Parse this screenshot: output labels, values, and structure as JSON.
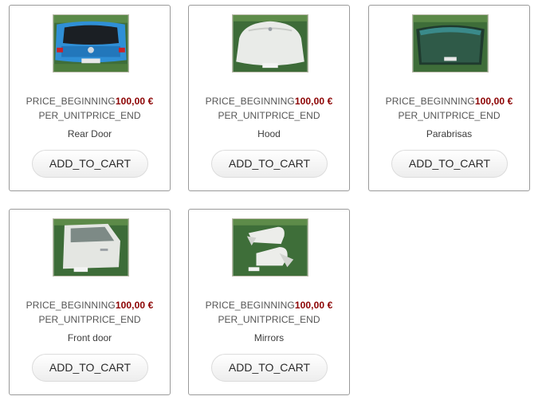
{
  "price_label": "PRICE_BEGINNING",
  "unit_label": "PER_UNITPRICE_END",
  "button_label": "ADD_TO_CART",
  "products": [
    {
      "name": "Rear Door",
      "price": "100,00 €",
      "image_icon": "rear-door-image"
    },
    {
      "name": "Hood",
      "price": "100,00 €",
      "image_icon": "hood-image"
    },
    {
      "name": "Parabrisas",
      "price": "100,00 €",
      "image_icon": "windshield-image"
    },
    {
      "name": "Front door",
      "price": "100,00 €",
      "image_icon": "front-door-image"
    },
    {
      "name": "Mirrors",
      "price": "100,00 €",
      "image_icon": "mirrors-image"
    }
  ],
  "colors": {
    "price_amount": "#8b0000",
    "label_text": "#555555",
    "card_border": "#9a9a9a",
    "thumb_background": "#4a7a3a"
  }
}
